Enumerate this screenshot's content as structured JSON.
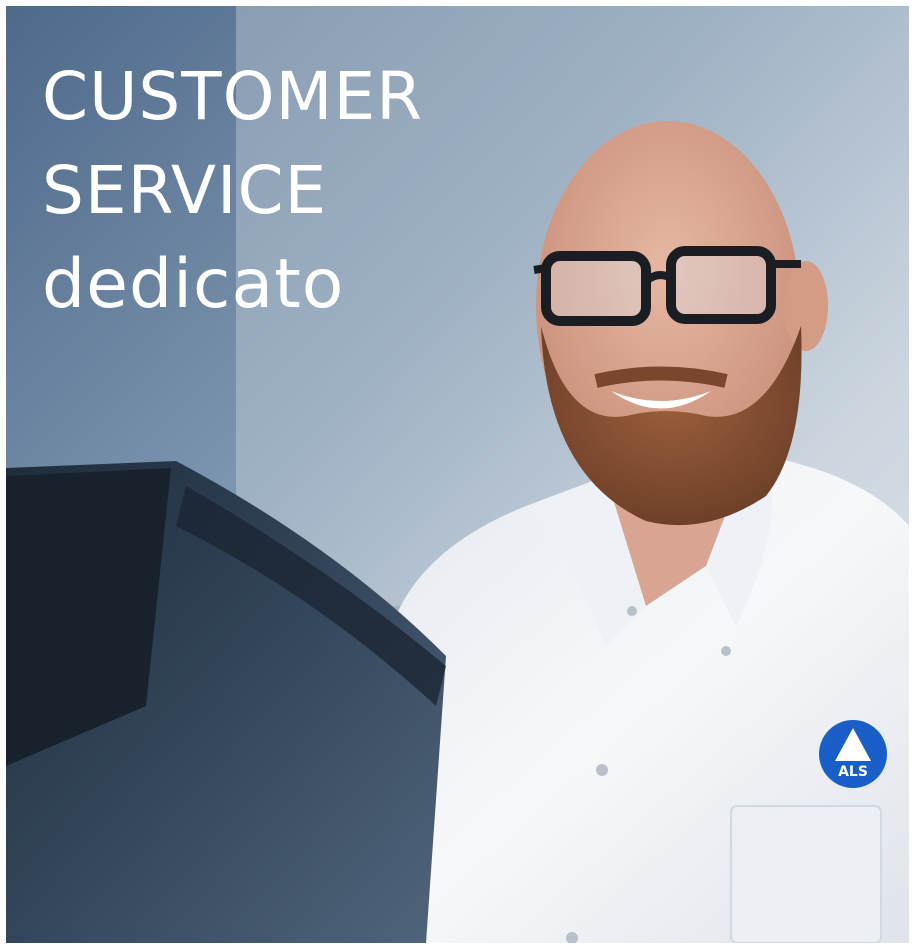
{
  "headline": {
    "line1": "CUSTOMER",
    "line2": "SERVICE",
    "line3": "dedicato"
  },
  "logo": {
    "text": "ALS",
    "color": "#1a5fc8"
  },
  "colors": {
    "text": "#ffffff",
    "coat": "#f3f5f8",
    "machine": "#2f3e50"
  }
}
